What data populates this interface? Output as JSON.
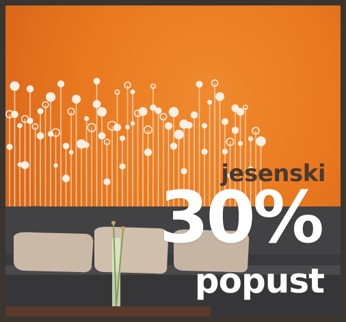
{
  "promo": {
    "line1": "jesenski",
    "discount": "30%",
    "line3": "popust"
  },
  "colors": {
    "wall": "#e9781f",
    "sofa": "#3c3c3e",
    "cushion": "#c9b7a6",
    "frame": "#3b3530",
    "text_dark": "#4a3a30",
    "text_light": "#ffffff"
  }
}
